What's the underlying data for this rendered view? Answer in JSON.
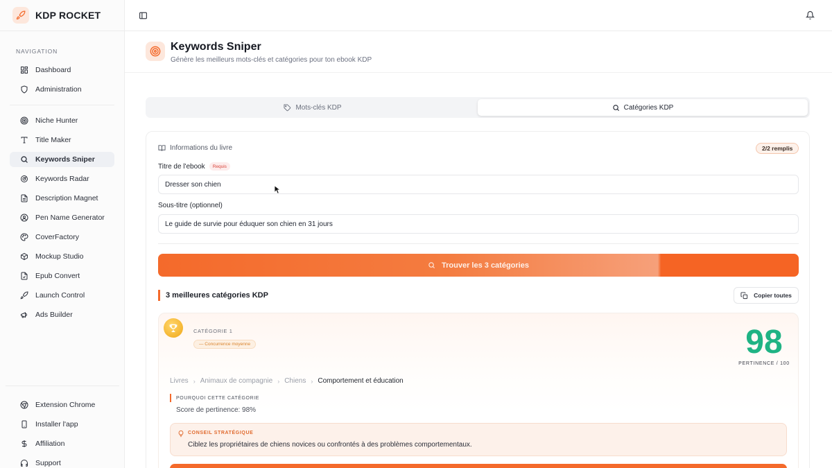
{
  "brand": {
    "name": "KDP ROCKET",
    "accent": "#f46a2b"
  },
  "sidebar": {
    "heading": "NAVIGATION",
    "items": [
      {
        "label": "Dashboard",
        "icon": "grid-icon"
      },
      {
        "label": "Administration",
        "icon": "shield-icon"
      },
      {
        "label": "Niche Hunter",
        "icon": "target-icon"
      },
      {
        "label": "Title Maker",
        "icon": "type-icon"
      },
      {
        "label": "Keywords Sniper",
        "icon": "search-icon",
        "active": true
      },
      {
        "label": "Keywords Radar",
        "icon": "radar-icon"
      },
      {
        "label": "Description Magnet",
        "icon": "file-text-icon"
      },
      {
        "label": "Pen Name Generator",
        "icon": "user-circle-icon"
      },
      {
        "label": "CoverFactory",
        "icon": "palette-icon"
      },
      {
        "label": "Mockup Studio",
        "icon": "box-icon"
      },
      {
        "label": "Epub Convert",
        "icon": "file-convert-icon"
      },
      {
        "label": "Launch Control",
        "icon": "rocket-icon"
      },
      {
        "label": "Ads Builder",
        "icon": "megaphone-icon"
      }
    ],
    "footer_items": [
      {
        "label": "Extension Chrome",
        "icon": "chrome-icon"
      },
      {
        "label": "Installer l'app",
        "icon": "smartphone-icon"
      },
      {
        "label": "Affiliation",
        "icon": "dollar-icon"
      },
      {
        "label": "Support",
        "icon": "headphones-icon"
      }
    ]
  },
  "page": {
    "title": "Keywords Sniper",
    "subtitle": "Génère les meilleurs mots-clés et catégories pour ton ebook KDP"
  },
  "tabs": [
    {
      "label": "Mots-clés KDP",
      "icon": "tag-icon",
      "active": false
    },
    {
      "label": "Catégories KDP",
      "icon": "search-icon",
      "active": true
    }
  ],
  "form": {
    "section_title": "Informations du livre",
    "filled_badge": "2/2 remplis",
    "title_label": "Titre de l'ebook",
    "required_badge": "Requis",
    "title_value": "Dresser son chien",
    "subtitle_label": "Sous-titre (optionnel)",
    "subtitle_value": "Le guide de survie pour éduquer son chien en 31 jours",
    "cta_label": "Trouver les 3 catégories"
  },
  "results": {
    "title": "3 meilleures catégories KDP",
    "copy_all": "Copier toutes",
    "categories": [
      {
        "label": "CATÉGORIE 1",
        "competition": "— Concurrence moyenne",
        "score": "98",
        "score_label": "PERTINENCE / 100",
        "breadcrumb": [
          "Livres",
          "Animaux de compagnie",
          "Chiens",
          "Comportement et éducation"
        ],
        "why_heading": "POURQUOI CETTE CATÉGORIE",
        "why_text": "Score de pertinence: 98%",
        "tip_heading": "CONSEIL STRATÉGIQUE",
        "tip_text": "Ciblez les propriétaires de chiens novices ou confrontés à des problèmes comportementaux."
      }
    ]
  },
  "colors": {
    "score": "#1fb384",
    "accent": "#f46a2b",
    "required": "#d9453b"
  }
}
